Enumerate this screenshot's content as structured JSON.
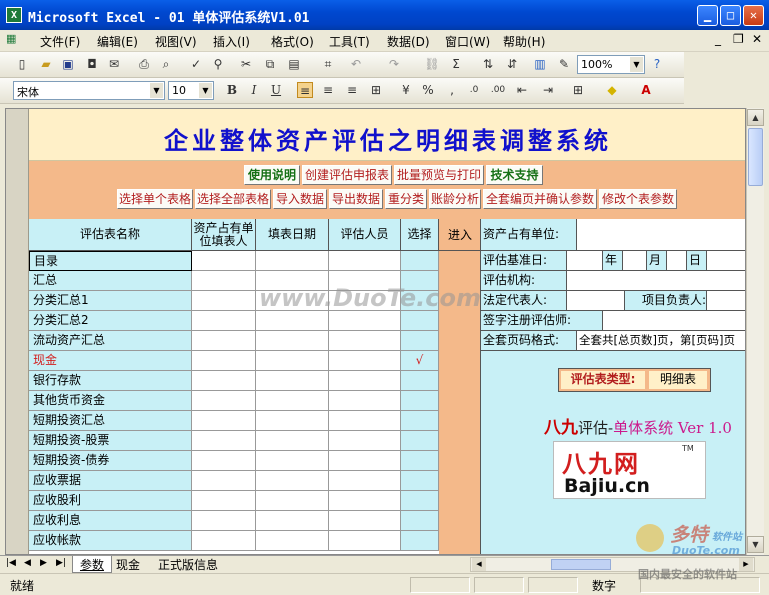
{
  "window": {
    "title": "Microsoft Excel - 01 单体评估系统V1.01",
    "app_icon": "X"
  },
  "menu": [
    "文件(F)",
    "编辑(E)",
    "视图(V)",
    "插入(I)",
    "格式(O)",
    "工具(T)",
    "数据(D)",
    "窗口(W)",
    "帮助(H)"
  ],
  "toolbar": {
    "zoom": "100%",
    "font": "宋体",
    "size": "10"
  },
  "banner": {
    "title": "企业整体资产评估之明细表调整系统"
  },
  "buttons_row1": [
    "使用说明",
    "创建评估申报表",
    "批量预览与打印",
    "技术支持"
  ],
  "buttons_row2": [
    "选择单个表格",
    "选择全部表格",
    "导入数据",
    "导出数据",
    "重分类",
    "账龄分析",
    "全套编页并确认参数",
    "修改个表参数"
  ],
  "table_headers": {
    "name": "评估表名称",
    "filler": "资产占有单位填表人",
    "date": "填表日期",
    "assessor": "评估人员",
    "select": "选择",
    "enter": "进入"
  },
  "rows": [
    {
      "name": "目录",
      "check": "",
      "red": false
    },
    {
      "name": "汇总",
      "check": "",
      "red": false
    },
    {
      "name": "分类汇总1",
      "check": "",
      "red": false
    },
    {
      "name": "分类汇总2",
      "check": "",
      "red": false
    },
    {
      "name": "流动资产汇总",
      "check": "",
      "red": false
    },
    {
      "name": "现金",
      "check": "√",
      "red": true
    },
    {
      "name": "银行存款",
      "check": "",
      "red": false
    },
    {
      "name": "其他货币资金",
      "check": "",
      "red": false
    },
    {
      "name": "短期投资汇总",
      "check": "",
      "red": false
    },
    {
      "name": "短期投资-股票",
      "check": "",
      "red": false
    },
    {
      "name": "短期投资-债券",
      "check": "",
      "red": false
    },
    {
      "name": "应收票据",
      "check": "",
      "red": false
    },
    {
      "name": "应收股利",
      "check": "",
      "red": false
    },
    {
      "name": "应收利息",
      "check": "",
      "red": false
    },
    {
      "name": "应收帐款",
      "check": "",
      "red": false
    }
  ],
  "right_panel": {
    "owner": "资产占有单位:",
    "base_date": "评估基准日:",
    "year": "年",
    "month": "月",
    "day": "日",
    "org": "评估机构:",
    "legal_rep": "法定代表人:",
    "project_lead": "项目负责人:",
    "signer": "签字注册评估师:",
    "page_format_label": "全套页码格式:",
    "page_format_value": "全套共[总页数]页，第[页码]页",
    "type_label": "评估表类型:",
    "type_value": "明细表",
    "version_brand": "八九",
    "version_mid": "评估-",
    "version_tail": "单体系统 Ver 1.0",
    "logo_text": "Bajiu.cn",
    "logo_cn": "八九网",
    "logo_tm": "TM"
  },
  "sheets": [
    "参数",
    "现金",
    "正式版信息"
  ],
  "status": {
    "ready": "就绪",
    "mode": "数字"
  },
  "watermarks": {
    "center": "www.DuoTe.com",
    "corner_brand": "多特",
    "corner_sub": "软件站",
    "corner_url": "DuoTe.com",
    "corner_slogan": "国内最安全的软件站"
  }
}
